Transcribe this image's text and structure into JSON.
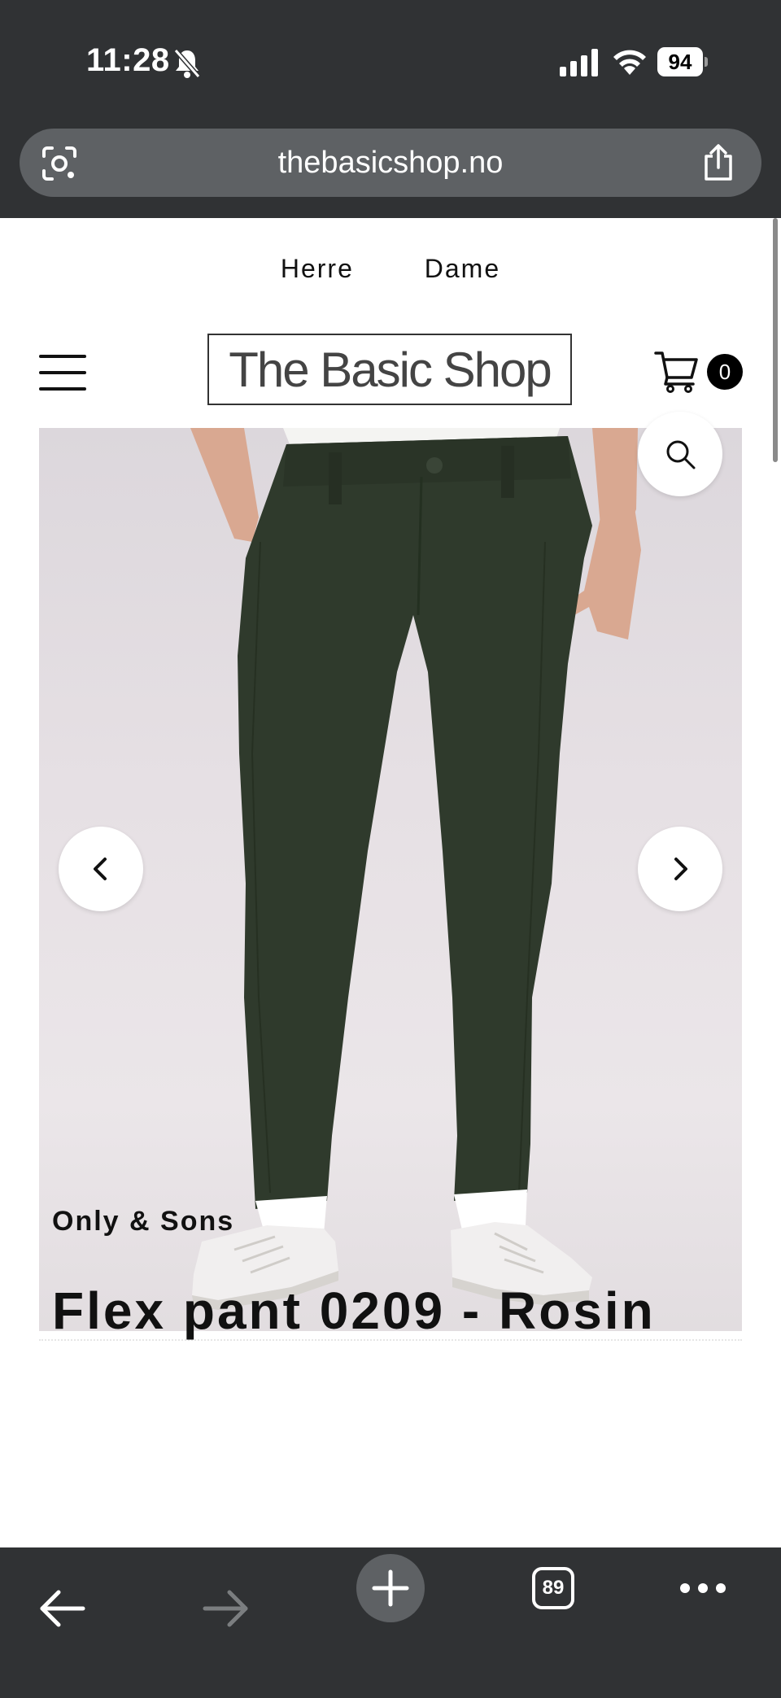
{
  "status_bar": {
    "time": "11:28",
    "battery": "94"
  },
  "browser": {
    "url": "thebasicshop.no",
    "tab_count": "89"
  },
  "site": {
    "top_nav": [
      "Herre",
      "Dame"
    ],
    "logo": "The Basic Shop",
    "cart_count": "0"
  },
  "product": {
    "vendor": "Only & Sons",
    "title": "Flex pant 0209 - Rosin"
  },
  "colors": {
    "chrome": "#303234",
    "url_bar": "#5e6164",
    "pants": "#2f3a2c"
  },
  "icons": {
    "status": [
      "bell-muted-icon",
      "signal-icon",
      "wifi-icon",
      "battery-icon"
    ],
    "url_bar": [
      "lens-icon",
      "share-icon"
    ],
    "header": [
      "hamburger-icon",
      "cart-icon"
    ],
    "gallery": [
      "zoom-icon",
      "chevron-left-icon",
      "chevron-right-icon"
    ],
    "toolbar": [
      "back-arrow-icon",
      "forward-arrow-icon",
      "plus-icon",
      "tabs-icon",
      "more-icon"
    ]
  }
}
